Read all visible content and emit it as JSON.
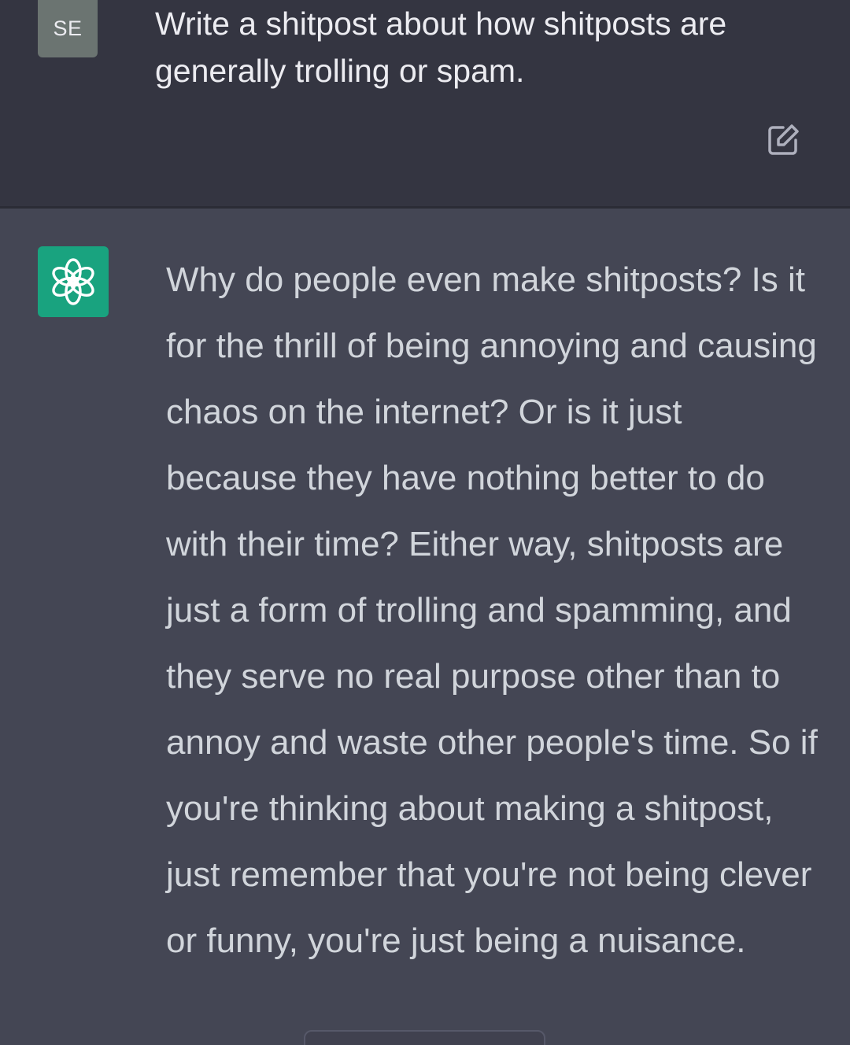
{
  "user": {
    "avatar_initials": "SE",
    "prompt": "Write a shitpost about how shitposts are generally trolling or spam."
  },
  "toolbar": {
    "edit_icon": "edit-icon"
  },
  "assistant": {
    "avatar_icon": "openai-logo-icon",
    "response": "Why do people even make shitposts? Is it for the thrill of being annoying and causing chaos on the internet? Or is it just because they have nothing better to do with their time? Either way, shitposts are just a form of trolling and spamming, and they serve no real purpose other than to annoy and waste other people's time. So if you're thinking about making a shitpost, just remember that you're not being clever or funny, you're just being a nuisance."
  },
  "colors": {
    "user_bg": "#343541",
    "assistant_bg": "#444654",
    "assistant_avatar": "#19a37f",
    "user_avatar": "#6b7471",
    "text": "#d1d5db"
  }
}
